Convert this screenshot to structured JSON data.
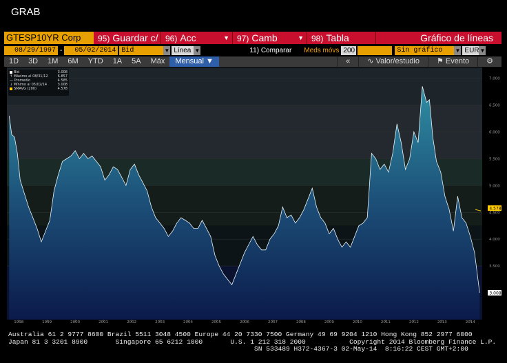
{
  "window": {
    "title": "GRAB"
  },
  "command_bar": {
    "ticker": "GTESP10YR Corp",
    "buttons": [
      {
        "num": "95)",
        "label": "Guardar c/",
        "dropdown": false
      },
      {
        "num": "96)",
        "label": "Acc",
        "dropdown": true
      },
      {
        "num": "97)",
        "label": "Camb",
        "dropdown": true
      },
      {
        "num": "98)",
        "label": "Tabla",
        "dropdown": false
      }
    ],
    "chart_type": "Gráfico de líneas"
  },
  "params": {
    "start_date": "08/29/1997",
    "end_date": "05/02/2014",
    "field": "Bid",
    "line_type": "Línea",
    "compare": "11) Comparar",
    "moving_avg_label": "Meds móvs",
    "moving_avg_value": "200",
    "chart_option": "Sin gráfico inferi",
    "currency": "EUR"
  },
  "toolbar": {
    "periods": [
      "1D",
      "3D",
      "1M",
      "6M",
      "YTD",
      "1A",
      "5A",
      "Máx"
    ],
    "active_period": "Mensual",
    "right": [
      "Valor/estudio",
      "Evento"
    ]
  },
  "legend": {
    "rows": [
      {
        "label": "Bid",
        "value": "3.008"
      },
      {
        "label": "Máximo al 08/31/12",
        "value": "6.857"
      },
      {
        "label": "Promedio",
        "value": "4.585"
      },
      {
        "label": "Mínimo al 05/02/14",
        "value": "3.008"
      },
      {
        "label": "SMAVG (200)",
        "value": "4.578"
      }
    ]
  },
  "colors": {
    "accent": "#c8102e",
    "field": "#e8a000",
    "series": "#2e7f96",
    "sma": "#ffcc00"
  },
  "chart_data": {
    "type": "area",
    "x_ticks": [
      "1997",
      "1998",
      "1999",
      "2000",
      "2001",
      "2002",
      "2003",
      "2004",
      "2005",
      "2006",
      "2007",
      "2008",
      "2009",
      "2010",
      "2011",
      "2012",
      "2013",
      "2014"
    ],
    "y_ticks": [
      "7.000",
      "6.500",
      "6.000",
      "5.500",
      "5.000",
      "4.500",
      "4.000",
      "3.500",
      "3.008"
    ],
    "ylim": [
      2.5,
      7.2
    ],
    "last_value_label": "3.008",
    "sma_label": "4.578",
    "series": [
      {
        "name": "Bid",
        "x": [
          1997.66,
          1997.75,
          1997.85,
          1997.95,
          1998.05,
          1998.2,
          1998.35,
          1998.5,
          1998.65,
          1998.8,
          1998.95,
          1999.1,
          1999.25,
          1999.4,
          1999.55,
          1999.7,
          1999.85,
          2000.0,
          2000.15,
          2000.3,
          2000.45,
          2000.6,
          2000.75,
          2000.9,
          2001.05,
          2001.2,
          2001.35,
          2001.5,
          2001.65,
          2001.8,
          2001.95,
          2002.1,
          2002.25,
          2002.4,
          2002.55,
          2002.7,
          2002.85,
          2003.0,
          2003.15,
          2003.3,
          2003.45,
          2003.6,
          2003.75,
          2003.9,
          2004.05,
          2004.2,
          2004.35,
          2004.5,
          2004.65,
          2004.8,
          2004.95,
          2005.1,
          2005.25,
          2005.4,
          2005.55,
          2005.7,
          2005.85,
          2006.0,
          2006.15,
          2006.3,
          2006.45,
          2006.6,
          2006.75,
          2006.9,
          2007.05,
          2007.2,
          2007.35,
          2007.5,
          2007.65,
          2007.8,
          2007.95,
          2008.1,
          2008.25,
          2008.4,
          2008.55,
          2008.7,
          2008.85,
          2009.0,
          2009.15,
          2009.3,
          2009.45,
          2009.6,
          2009.75,
          2009.9,
          2010.05,
          2010.2,
          2010.35,
          2010.5,
          2010.65,
          2010.8,
          2010.95,
          2011.1,
          2011.25,
          2011.4,
          2011.55,
          2011.7,
          2011.85,
          2012.0,
          2012.15,
          2012.3,
          2012.45,
          2012.55,
          2012.67,
          2012.8,
          2012.95,
          2013.1,
          2013.25,
          2013.4,
          2013.55,
          2013.7,
          2013.85,
          2014.0,
          2014.15,
          2014.33
        ],
        "y": [
          6.3,
          5.95,
          5.9,
          5.6,
          5.1,
          4.85,
          4.6,
          4.4,
          4.2,
          3.95,
          4.15,
          4.35,
          4.9,
          5.2,
          5.45,
          5.5,
          5.55,
          5.65,
          5.5,
          5.6,
          5.5,
          5.55,
          5.45,
          5.35,
          5.1,
          5.2,
          5.35,
          5.3,
          5.15,
          5.0,
          5.3,
          5.4,
          5.2,
          5.05,
          4.9,
          4.6,
          4.4,
          4.3,
          4.2,
          4.05,
          4.15,
          4.3,
          4.4,
          4.35,
          4.3,
          4.2,
          4.2,
          4.35,
          4.2,
          4.05,
          3.7,
          3.5,
          3.35,
          3.25,
          3.15,
          3.35,
          3.55,
          3.75,
          3.9,
          4.05,
          3.9,
          3.8,
          3.8,
          4.0,
          4.1,
          4.25,
          4.6,
          4.4,
          4.45,
          4.3,
          4.4,
          4.55,
          4.75,
          4.95,
          4.6,
          4.4,
          4.3,
          4.1,
          4.2,
          4.0,
          3.85,
          3.95,
          3.85,
          4.05,
          4.25,
          4.3,
          4.4,
          5.6,
          5.5,
          5.3,
          5.4,
          5.25,
          5.6,
          6.15,
          5.8,
          5.3,
          5.5,
          6.0,
          5.8,
          6.85,
          6.55,
          6.6,
          5.9,
          5.45,
          5.25,
          4.8,
          4.55,
          4.15,
          4.8,
          4.4,
          4.3,
          4.05,
          3.75,
          3.0
        ]
      }
    ]
  },
  "footer": {
    "line1": "Australia 61 2 9777 8600 Brazil 5511 3048 4500 Europe 44 20 7330 7500 Germany 49 69 9204 1210 Hong Kong 852 2977 6000",
    "line2": "Japan 81 3 3201 8900       Singapore 65 6212 1000       U.S. 1 212 318 2000           Copyright 2014 Bloomberg Finance L.P.",
    "line3": "                                                              SN 533489 H372-4367-3 02-May-14  8:16:22 CEST GMT+2:00"
  }
}
